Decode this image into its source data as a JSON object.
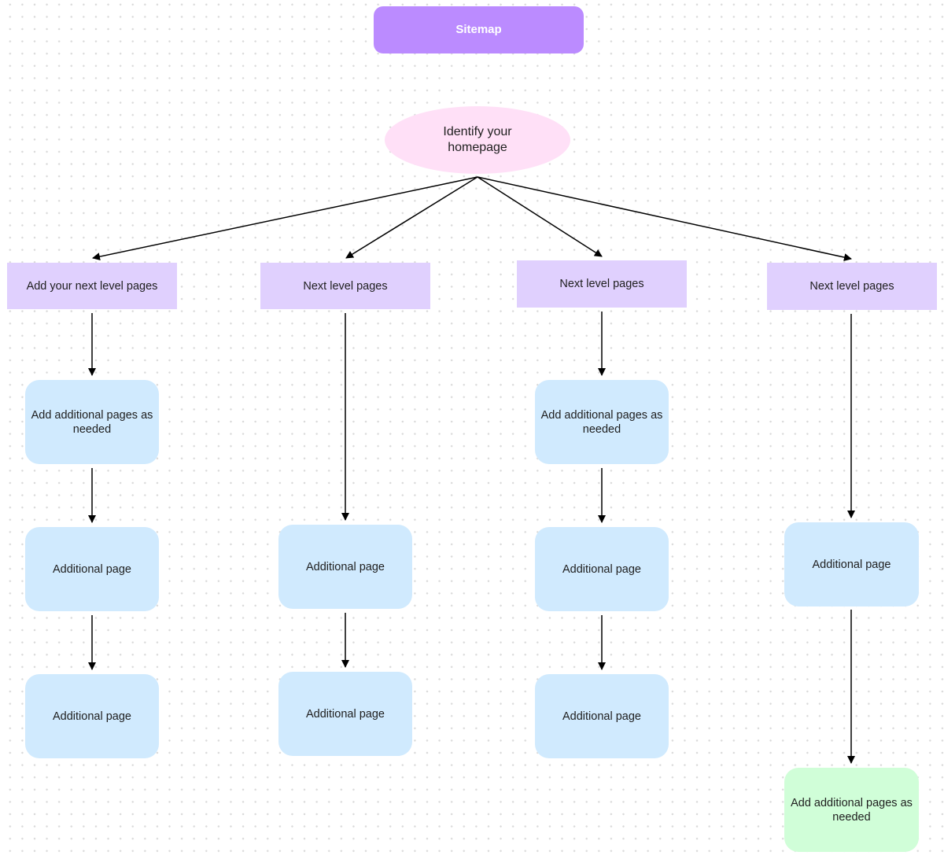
{
  "title": "Sitemap",
  "colors": {
    "title_fill": "#bb8bff",
    "home_fill": "#ffe0f7",
    "level_fill": "#e0d0fe",
    "page_fill": "#d0eafe",
    "final_fill": "#d0fed8",
    "edge": "#000000"
  },
  "home": {
    "label": "Identify your homepage"
  },
  "columns": [
    {
      "level": "Add your next level pages",
      "pages": [
        "Add additional pages as needed",
        "Additional page",
        "Additional page"
      ]
    },
    {
      "level": "Next level pages",
      "pages": [
        "Additional page",
        "Additional page"
      ]
    },
    {
      "level": "Next level pages",
      "pages": [
        "Add additional pages as needed",
        "Additional page",
        "Additional page"
      ]
    },
    {
      "level": "Next level pages",
      "pages": [
        "Additional page",
        "Add additional pages as needed"
      ]
    }
  ]
}
